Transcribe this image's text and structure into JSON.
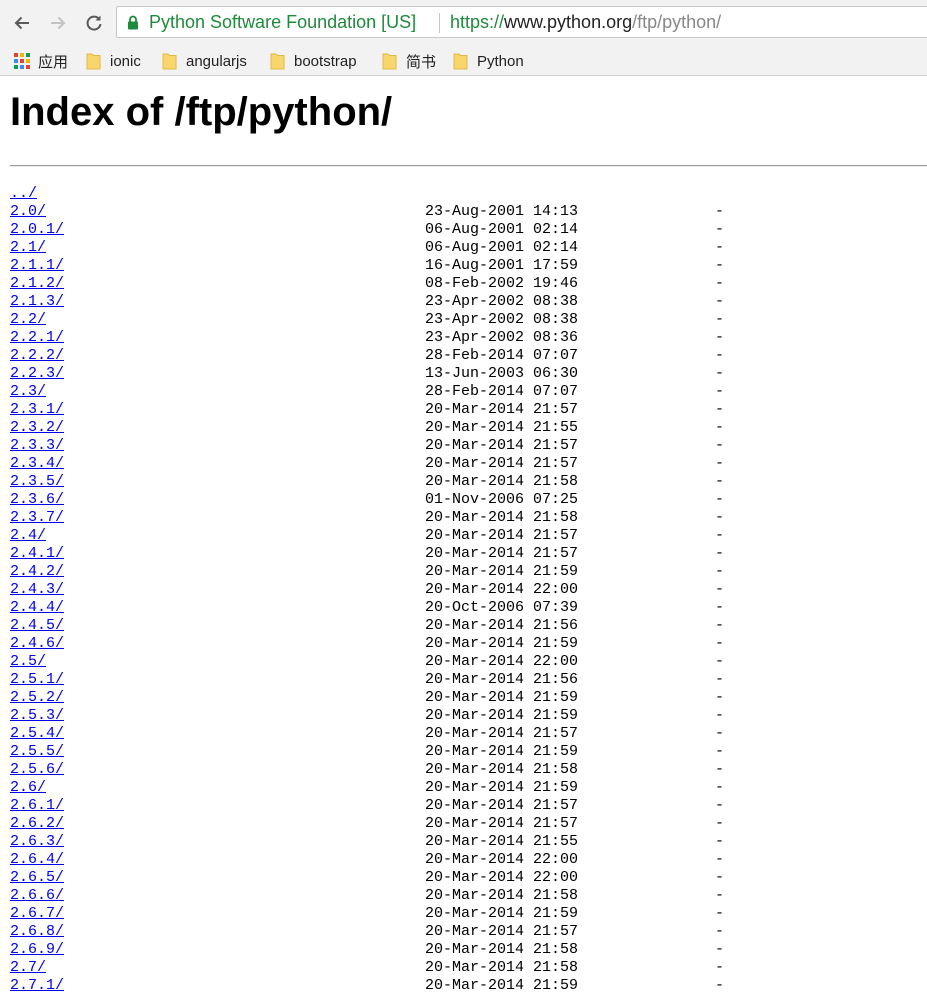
{
  "browser": {
    "site_name": "Python Software Foundation [US]",
    "url_scheme": "https://",
    "url_host": "www.python.org",
    "url_path": "/ftp/python/",
    "accent_green": "#1f8a3c"
  },
  "bookmarks": [
    {
      "label": "应用",
      "icon": "apps-grid-icon"
    },
    {
      "label": "ionic",
      "icon": "folder-icon"
    },
    {
      "label": "angularjs",
      "icon": "folder-icon"
    },
    {
      "label": "bootstrap",
      "icon": "folder-icon"
    },
    {
      "label": "简书",
      "icon": "folder-icon"
    },
    {
      "label": "Python",
      "icon": "folder-icon"
    }
  ],
  "page": {
    "title": "Index of /ftp/python/",
    "parent_link": "../"
  },
  "entries": [
    {
      "name": "2.0/",
      "date": "23-Aug-2001 14:13",
      "size": "-"
    },
    {
      "name": "2.0.1/",
      "date": "06-Aug-2001 02:14",
      "size": "-"
    },
    {
      "name": "2.1/",
      "date": "06-Aug-2001 02:14",
      "size": "-"
    },
    {
      "name": "2.1.1/",
      "date": "16-Aug-2001 17:59",
      "size": "-"
    },
    {
      "name": "2.1.2/",
      "date": "08-Feb-2002 19:46",
      "size": "-"
    },
    {
      "name": "2.1.3/",
      "date": "23-Apr-2002 08:38",
      "size": "-"
    },
    {
      "name": "2.2/",
      "date": "23-Apr-2002 08:38",
      "size": "-"
    },
    {
      "name": "2.2.1/",
      "date": "23-Apr-2002 08:36",
      "size": "-"
    },
    {
      "name": "2.2.2/",
      "date": "28-Feb-2014 07:07",
      "size": "-"
    },
    {
      "name": "2.2.3/",
      "date": "13-Jun-2003 06:30",
      "size": "-"
    },
    {
      "name": "2.3/",
      "date": "28-Feb-2014 07:07",
      "size": "-"
    },
    {
      "name": "2.3.1/",
      "date": "20-Mar-2014 21:57",
      "size": "-"
    },
    {
      "name": "2.3.2/",
      "date": "20-Mar-2014 21:55",
      "size": "-"
    },
    {
      "name": "2.3.3/",
      "date": "20-Mar-2014 21:57",
      "size": "-"
    },
    {
      "name": "2.3.4/",
      "date": "20-Mar-2014 21:57",
      "size": "-"
    },
    {
      "name": "2.3.5/",
      "date": "20-Mar-2014 21:58",
      "size": "-"
    },
    {
      "name": "2.3.6/",
      "date": "01-Nov-2006 07:25",
      "size": "-"
    },
    {
      "name": "2.3.7/",
      "date": "20-Mar-2014 21:58",
      "size": "-"
    },
    {
      "name": "2.4/",
      "date": "20-Mar-2014 21:57",
      "size": "-"
    },
    {
      "name": "2.4.1/",
      "date": "20-Mar-2014 21:57",
      "size": "-"
    },
    {
      "name": "2.4.2/",
      "date": "20-Mar-2014 21:59",
      "size": "-"
    },
    {
      "name": "2.4.3/",
      "date": "20-Mar-2014 22:00",
      "size": "-"
    },
    {
      "name": "2.4.4/",
      "date": "20-Oct-2006 07:39",
      "size": "-"
    },
    {
      "name": "2.4.5/",
      "date": "20-Mar-2014 21:56",
      "size": "-"
    },
    {
      "name": "2.4.6/",
      "date": "20-Mar-2014 21:59",
      "size": "-"
    },
    {
      "name": "2.5/",
      "date": "20-Mar-2014 22:00",
      "size": "-"
    },
    {
      "name": "2.5.1/",
      "date": "20-Mar-2014 21:56",
      "size": "-"
    },
    {
      "name": "2.5.2/",
      "date": "20-Mar-2014 21:59",
      "size": "-"
    },
    {
      "name": "2.5.3/",
      "date": "20-Mar-2014 21:59",
      "size": "-"
    },
    {
      "name": "2.5.4/",
      "date": "20-Mar-2014 21:57",
      "size": "-"
    },
    {
      "name": "2.5.5/",
      "date": "20-Mar-2014 21:59",
      "size": "-"
    },
    {
      "name": "2.5.6/",
      "date": "20-Mar-2014 21:58",
      "size": "-"
    },
    {
      "name": "2.6/",
      "date": "20-Mar-2014 21:59",
      "size": "-"
    },
    {
      "name": "2.6.1/",
      "date": "20-Mar-2014 21:57",
      "size": "-"
    },
    {
      "name": "2.6.2/",
      "date": "20-Mar-2014 21:57",
      "size": "-"
    },
    {
      "name": "2.6.3/",
      "date": "20-Mar-2014 21:55",
      "size": "-"
    },
    {
      "name": "2.6.4/",
      "date": "20-Mar-2014 22:00",
      "size": "-"
    },
    {
      "name": "2.6.5/",
      "date": "20-Mar-2014 22:00",
      "size": "-"
    },
    {
      "name": "2.6.6/",
      "date": "20-Mar-2014 21:58",
      "size": "-"
    },
    {
      "name": "2.6.7/",
      "date": "20-Mar-2014 21:59",
      "size": "-"
    },
    {
      "name": "2.6.8/",
      "date": "20-Mar-2014 21:57",
      "size": "-"
    },
    {
      "name": "2.6.9/",
      "date": "20-Mar-2014 21:58",
      "size": "-"
    },
    {
      "name": "2.7/",
      "date": "20-Mar-2014 21:58",
      "size": "-"
    },
    {
      "name": "2.7.1/",
      "date": "20-Mar-2014 21:59",
      "size": "-"
    }
  ]
}
